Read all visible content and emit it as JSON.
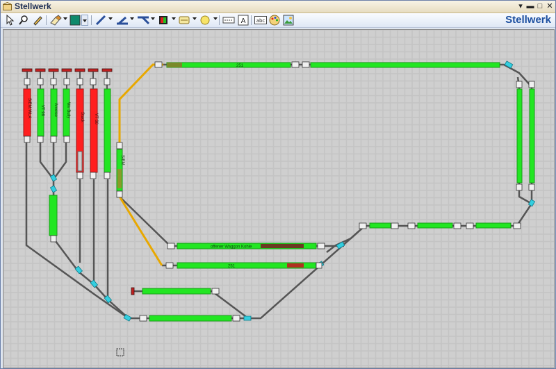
{
  "window": {
    "title": "Stellwerk"
  },
  "toolbar": {
    "brand": "Stellwerk",
    "accent_color": "#0f8a6c",
    "icons": [
      "select-arrow-icon",
      "zoom-search-icon",
      "pencil-icon",
      "eraser-brush-icon",
      "color-fill-icon",
      "line-tool-icon",
      "track-tool-icon",
      "switch-tool-icon",
      "signal-tool-icon",
      "block-tool-icon",
      "circle-tool-icon",
      "text-label-icon",
      "text-box-icon",
      "abc-text-icon",
      "palette-icon",
      "image-icon"
    ]
  },
  "layout": {
    "track_color": "#555555",
    "track_highlight_color": "#e8a800",
    "block_free_color": "#22e622",
    "block_occupied_color": "#ff1f1f",
    "switch_color": "#33cfe0",
    "grid_bg": "#c8c8c8"
  },
  "blocks": {
    "top_main": "251",
    "middle_upper": "offener Waggon Kohle",
    "middle_lower": "251",
    "vertical_left": "SIEM",
    "siding_1": "SIEM.WLA",
    "siding_2": "VT 98",
    "siding_3": "Ameise",
    "siding_4": "Wv Bully",
    "siding_5": "Stack",
    "siding_6": "VT 30"
  }
}
